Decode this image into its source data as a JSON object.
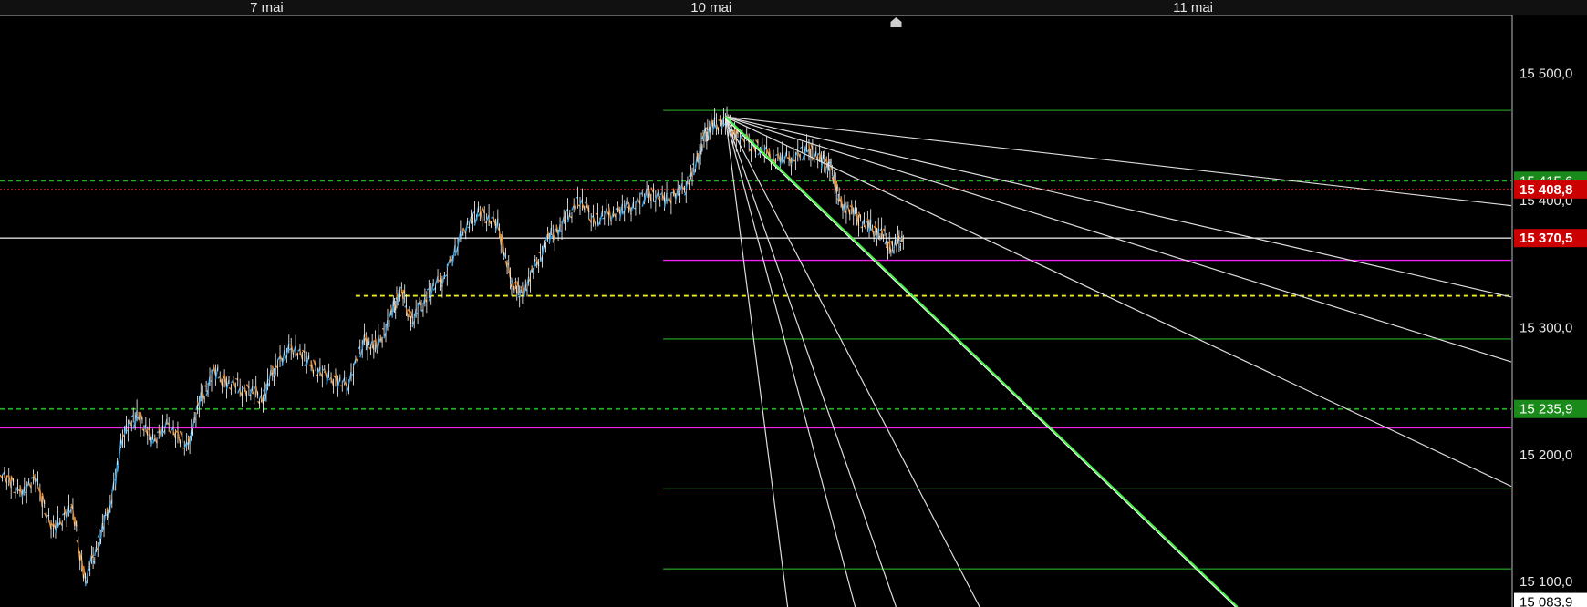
{
  "chart_data": {
    "type": "candlestick",
    "time_axis": {
      "labels": [
        {
          "text": "7 mai",
          "t": 1.5
        },
        {
          "text": "10 mai",
          "t": 4.0
        },
        {
          "text": "11 mai",
          "t": 6.71
        }
      ],
      "range": [
        0,
        8.5
      ]
    },
    "price_axis": {
      "range": [
        15080,
        15545
      ],
      "ticks": [
        {
          "value": 15500,
          "text": "15 500,0"
        },
        {
          "value": 15400,
          "text": "15 400,0"
        },
        {
          "value": 15300,
          "text": "15 300,0"
        },
        {
          "value": 15200,
          "text": "15 200,0"
        },
        {
          "value": 15100,
          "text": "15 100,0"
        }
      ]
    },
    "price_badges": [
      {
        "value": 15415.6,
        "text": "15 415,6",
        "color": "#1a8a1a",
        "text_color": "#ffffff"
      },
      {
        "value": 15408.8,
        "text": "15 408,8",
        "color": "#cc0000",
        "text_color": "#ffffff"
      },
      {
        "value": 15370.5,
        "text": "15 370,5",
        "color": "#cc0000",
        "text_color": "#ffffff"
      },
      {
        "value": 15235.9,
        "text": "15 235,9",
        "color": "#1a8a1a",
        "text_color": "#ffffff"
      },
      {
        "value": 15083.9,
        "text": "15 083,9",
        "color": "#ffffff",
        "text_color": "#000000"
      }
    ],
    "horizontal_lines": [
      {
        "value": 15415.6,
        "color": "#22b022",
        "style": "dashed",
        "from_t": 0
      },
      {
        "value": 15408.8,
        "color": "#dd2222",
        "style": "dotted",
        "from_t": 0
      },
      {
        "value": 15370.5,
        "color": "#dddddd",
        "style": "solid",
        "from_t": 0
      },
      {
        "value": 15353.0,
        "color": "#ee22ee",
        "style": "solid",
        "from_t": 3.73
      },
      {
        "value": 15325.0,
        "color": "#eeee22",
        "style": "dashed",
        "from_t": 2.0
      },
      {
        "value": 15235.9,
        "color": "#22b022",
        "style": "dashed",
        "from_t": 0
      },
      {
        "value": 15221.0,
        "color": "#ee22ee",
        "style": "solid",
        "from_t": 0
      }
    ],
    "fib_levels": [
      15471.0,
      15291.0,
      15173.0,
      15110.0
    ],
    "fan": {
      "anchor": {
        "t": 4.08,
        "p": 15466.0
      },
      "targets": [
        {
          "t": 8.5,
          "p": 15396.0,
          "color": "#dddddd"
        },
        {
          "t": 8.5,
          "p": 15324.0,
          "color": "#dddddd"
        },
        {
          "t": 8.5,
          "p": 15273.0,
          "color": "#dddddd"
        },
        {
          "t": 8.5,
          "p": 15175.0,
          "color": "#dddddd"
        },
        {
          "t": 6.95,
          "p": 15080.0,
          "color": "#dddddd"
        },
        {
          "t": 5.51,
          "p": 15080.0,
          "color": "#dddddd"
        },
        {
          "t": 5.04,
          "p": 15080.0,
          "color": "#dddddd"
        },
        {
          "t": 4.81,
          "p": 15080.0,
          "color": "#dddddd"
        },
        {
          "t": 4.43,
          "p": 15080.0,
          "color": "#dddddd"
        }
      ],
      "main_line": {
        "to_t": 6.96,
        "to_p": 15080.0,
        "color": "#44ee44"
      }
    },
    "price_path": [
      [
        0.0,
        15190
      ],
      [
        0.1,
        15170
      ],
      [
        0.2,
        15180
      ],
      [
        0.3,
        15140
      ],
      [
        0.4,
        15160
      ],
      [
        0.48,
        15100
      ],
      [
        0.55,
        15130
      ],
      [
        0.62,
        15160
      ],
      [
        0.7,
        15220
      ],
      [
        0.78,
        15230
      ],
      [
        0.86,
        15210
      ],
      [
        0.95,
        15225
      ],
      [
        1.05,
        15205
      ],
      [
        1.12,
        15240
      ],
      [
        1.2,
        15265
      ],
      [
        1.3,
        15255
      ],
      [
        1.4,
        15250
      ],
      [
        1.48,
        15245
      ],
      [
        1.55,
        15270
      ],
      [
        1.65,
        15285
      ],
      [
        1.75,
        15270
      ],
      [
        1.85,
        15260
      ],
      [
        1.95,
        15255
      ],
      [
        2.05,
        15290
      ],
      [
        2.12,
        15285
      ],
      [
        2.2,
        15310
      ],
      [
        2.25,
        15330
      ],
      [
        2.32,
        15305
      ],
      [
        2.4,
        15325
      ],
      [
        2.5,
        15340
      ],
      [
        2.62,
        15380
      ],
      [
        2.7,
        15390
      ],
      [
        2.8,
        15380
      ],
      [
        2.87,
        15340
      ],
      [
        2.93,
        15325
      ],
      [
        3.0,
        15345
      ],
      [
        3.08,
        15370
      ],
      [
        3.16,
        15380
      ],
      [
        3.25,
        15400
      ],
      [
        3.35,
        15385
      ],
      [
        3.45,
        15390
      ],
      [
        3.55,
        15395
      ],
      [
        3.65,
        15405
      ],
      [
        3.75,
        15400
      ],
      [
        3.85,
        15410
      ],
      [
        3.92,
        15430
      ],
      [
        3.96,
        15450
      ],
      [
        4.0,
        15458
      ],
      [
        4.08,
        15464
      ],
      [
        4.15,
        15450
      ],
      [
        4.25,
        15443
      ],
      [
        4.35,
        15433
      ],
      [
        4.45,
        15433
      ],
      [
        4.55,
        15440
      ],
      [
        4.63,
        15430
      ],
      [
        4.68,
        15425
      ],
      [
        4.72,
        15400
      ],
      [
        4.8,
        15390
      ],
      [
        4.88,
        15380
      ],
      [
        4.95,
        15375
      ],
      [
        5.02,
        15362
      ],
      [
        5.08,
        15372
      ]
    ]
  },
  "icons": {
    "marker": "home-arrow-icon"
  }
}
